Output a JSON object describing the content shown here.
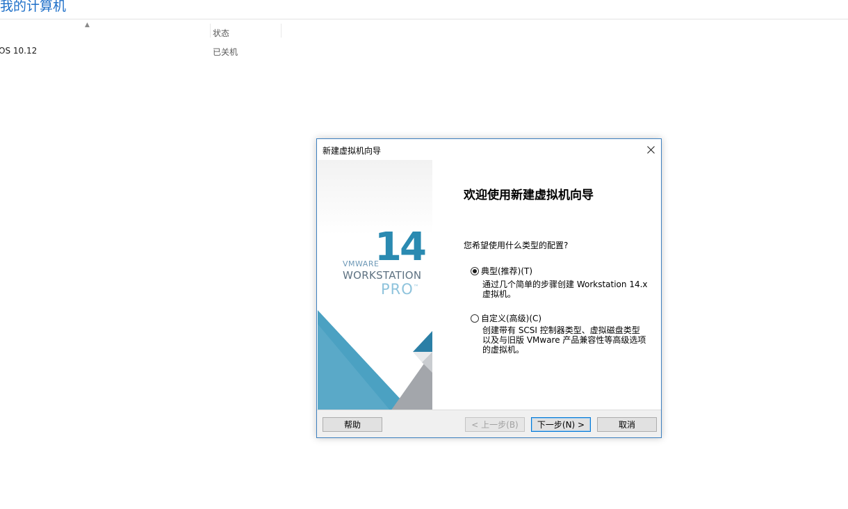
{
  "background": {
    "window_title": "我的计算机",
    "columns": {
      "status_header": "状态"
    },
    "rows": [
      {
        "name": "OS 10.12",
        "status": "已关机"
      }
    ]
  },
  "dialog": {
    "title": "新建虚拟机向导",
    "close_icon": "close-icon",
    "brand": {
      "vmware": "VMWARE",
      "version": "14",
      "product": "WORKSTATION",
      "edition": "PRO",
      "trademark": "™"
    },
    "heading": "欢迎使用新建虚拟机向导",
    "question": "您希望使用什么类型的配置?",
    "options": [
      {
        "label": "典型(推荐)(T)",
        "checked": true,
        "description": [
          "通过几个简单的步骤创建 Workstation 14.x",
          "虚拟机。"
        ]
      },
      {
        "label": "自定义(高级)(C)",
        "checked": false,
        "description": [
          "创建带有 SCSI 控制器类型、虚拟磁盘类型",
          "以及与旧版 VMware 产品兼容性等高级选项",
          "的虚拟机。"
        ]
      }
    ],
    "buttons": {
      "help": "帮助",
      "back": "< 上一步(B)",
      "next": "下一步(N) >",
      "cancel": "取消"
    },
    "colors": {
      "border": "#3c7fbf",
      "brand_blue": "#2a8ab1",
      "art_gray": "#a3a6ab",
      "art_blue": "#4ba1c2"
    }
  }
}
